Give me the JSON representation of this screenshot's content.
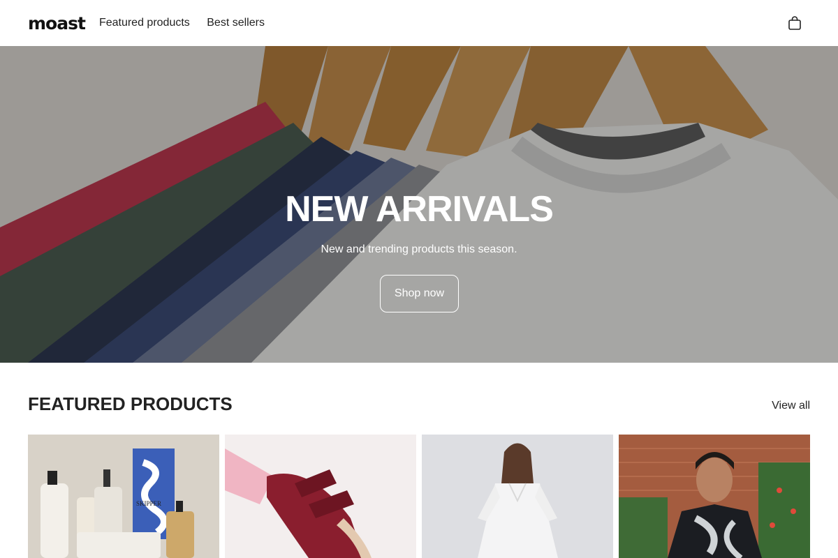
{
  "header": {
    "logo": "moast",
    "nav": [
      "Featured products",
      "Best sellers"
    ],
    "cart_icon": "shopping-bag-icon"
  },
  "hero": {
    "title": "NEW ARRIVALS",
    "subtitle": "New and trending products this season.",
    "button_label": "Shop now"
  },
  "featured": {
    "title": "FEATURED PRODUCTS",
    "view_all": "View all",
    "products": [
      {
        "image": "skincare-bottles-image",
        "brand_text": "SKIPPER"
      },
      {
        "image": "red-shoes-image"
      },
      {
        "image": "white-dress-image"
      },
      {
        "image": "patterned-shirt-man-image"
      }
    ]
  }
}
